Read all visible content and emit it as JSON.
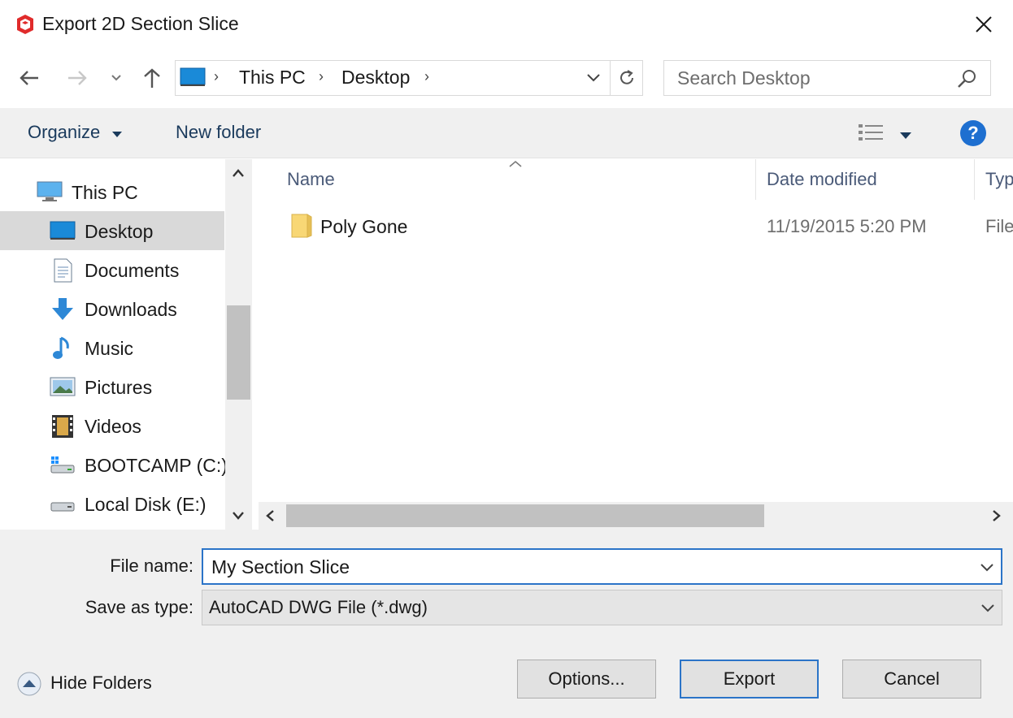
{
  "window": {
    "title": "Export 2D Section Slice",
    "app_icon": "sketchup-icon",
    "close_icon": "close-icon"
  },
  "nav": {
    "back_icon": "back-arrow-icon",
    "forward_icon": "forward-arrow-icon",
    "recent_icon": "chevron-down-icon",
    "up_icon": "up-arrow-icon",
    "breadcrumbs": [
      "This PC",
      "Desktop"
    ],
    "refresh_icon": "refresh-icon",
    "search_placeholder": "Search Desktop"
  },
  "toolbar": {
    "organize": "Organize",
    "new_folder": "New folder",
    "view_icon": "view-options-icon",
    "help_icon": "help-icon",
    "help_glyph": "?"
  },
  "sidebar": {
    "items": [
      {
        "label": "This PC",
        "icon": "this-pc-icon"
      },
      {
        "label": "Desktop",
        "icon": "desktop-icon",
        "selected": true
      },
      {
        "label": "Documents",
        "icon": "documents-icon"
      },
      {
        "label": "Downloads",
        "icon": "downloads-icon"
      },
      {
        "label": "Music",
        "icon": "music-icon"
      },
      {
        "label": "Pictures",
        "icon": "pictures-icon"
      },
      {
        "label": "Videos",
        "icon": "videos-icon"
      },
      {
        "label": "BOOTCAMP (C:)",
        "icon": "drive-c-icon"
      },
      {
        "label": "Local Disk (E:)",
        "icon": "drive-e-icon"
      }
    ]
  },
  "files": {
    "columns": [
      "Name",
      "Date modified",
      "Typ"
    ],
    "rows": [
      {
        "name": "Poly Gone",
        "date": "11/19/2015 5:20 PM",
        "type": "File",
        "icon": "folder-icon"
      }
    ]
  },
  "form": {
    "file_name_label": "File name:",
    "file_name_value": "My Section Slice",
    "save_type_label": "Save as type:",
    "save_type_value": "AutoCAD DWG File (*.dwg)"
  },
  "footer": {
    "hide_folders": "Hide Folders",
    "options": "Options...",
    "export": "Export",
    "cancel": "Cancel"
  },
  "colors": {
    "accent": "#2b74c8",
    "selected_bg": "#d9d9d9",
    "panel_bg": "#f0f0f0",
    "folder": "#f8d775"
  }
}
